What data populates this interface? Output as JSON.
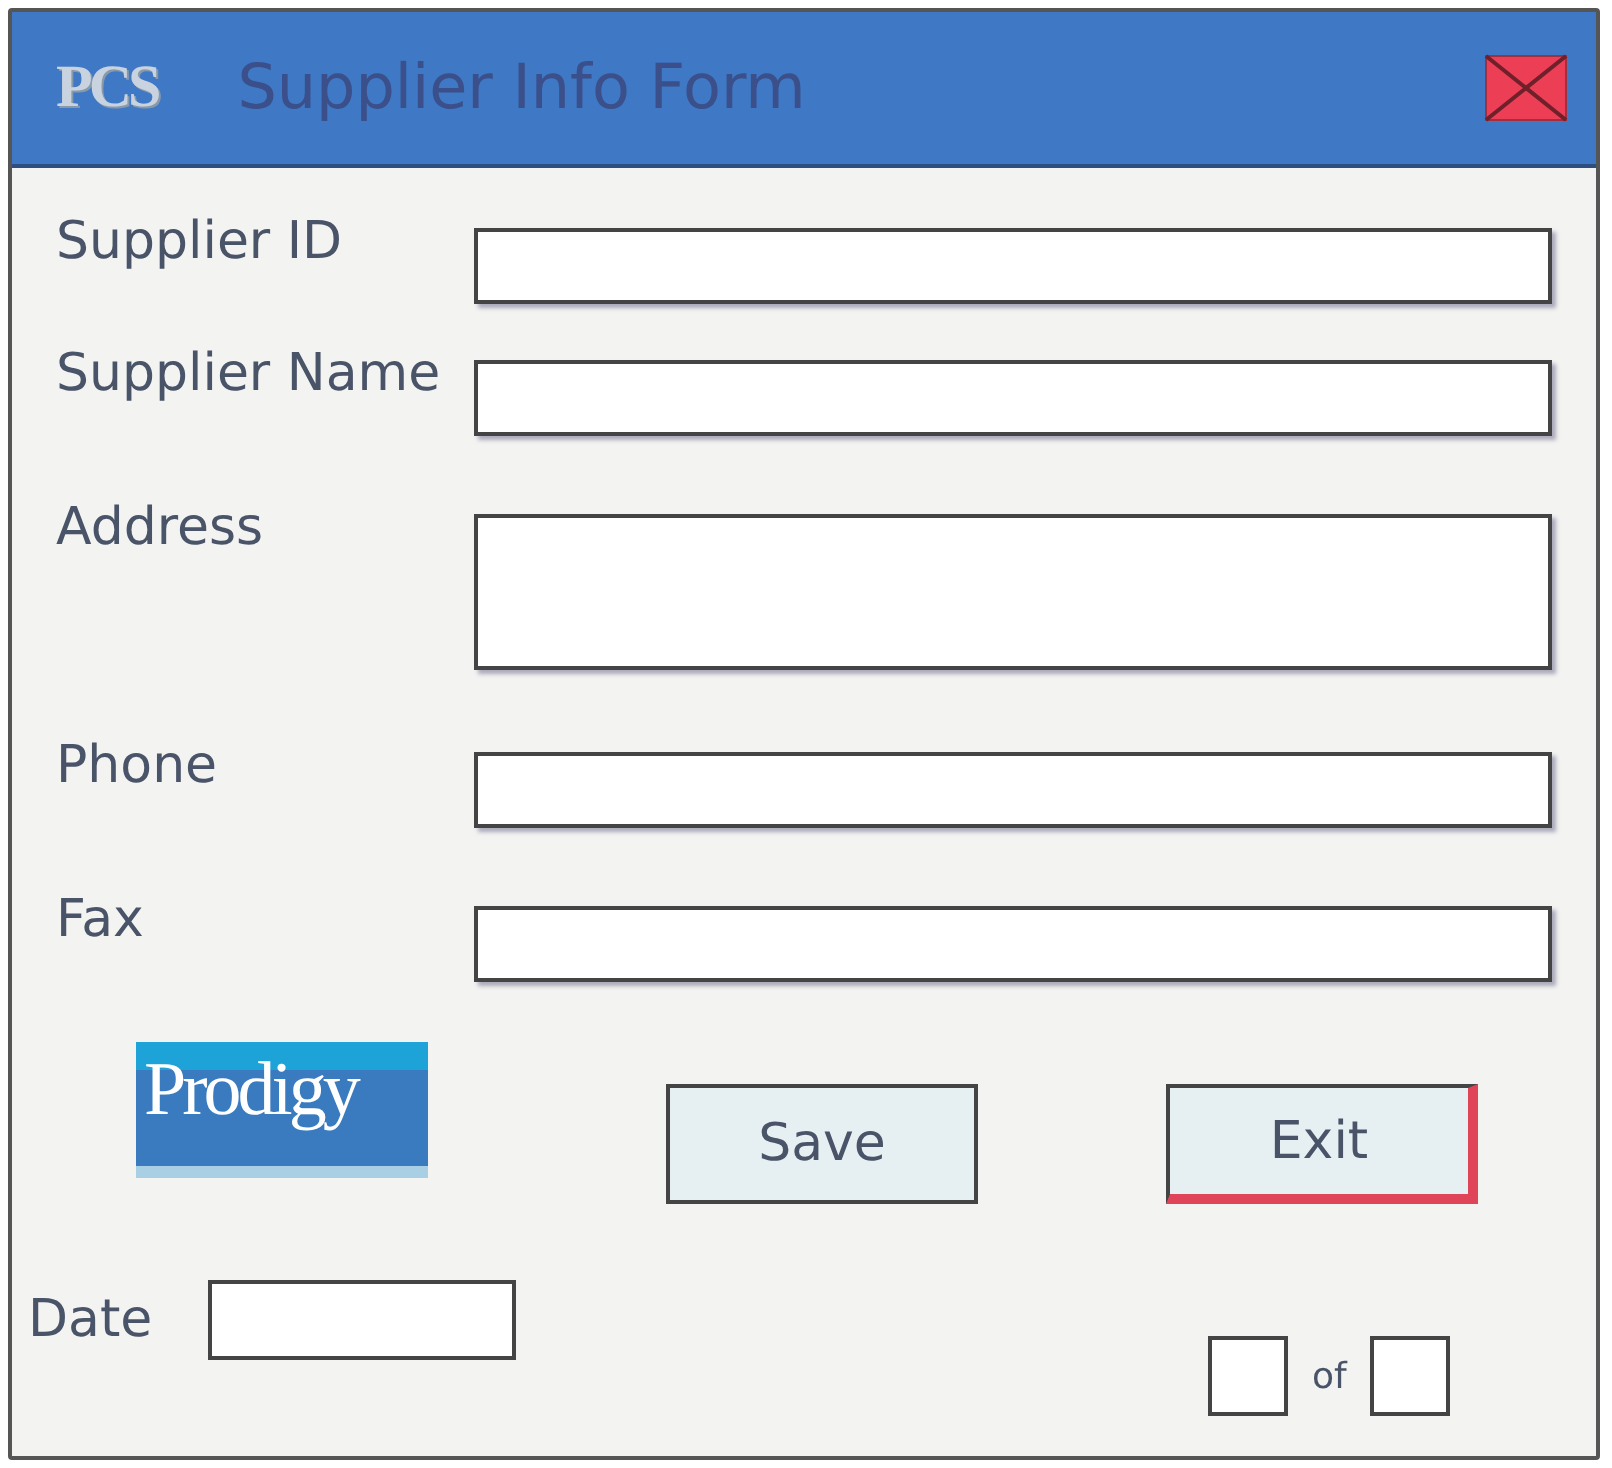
{
  "window": {
    "logo": "PCS",
    "title": "Supplier Info Form"
  },
  "fields": [
    {
      "label": "Supplier ID",
      "kind": "line"
    },
    {
      "label": "Supplier Name",
      "kind": "line"
    },
    {
      "label": "Address",
      "kind": "area"
    },
    {
      "label": "Phone",
      "kind": "line"
    },
    {
      "label": "Fax",
      "kind": "line"
    }
  ],
  "brand": {
    "logo": "Prodigy"
  },
  "buttons": [
    {
      "label": "Save",
      "focused": false
    },
    {
      "label": "Exit",
      "focused": true
    }
  ],
  "date": {
    "label": "Date"
  },
  "pager": {
    "separator": "of"
  }
}
